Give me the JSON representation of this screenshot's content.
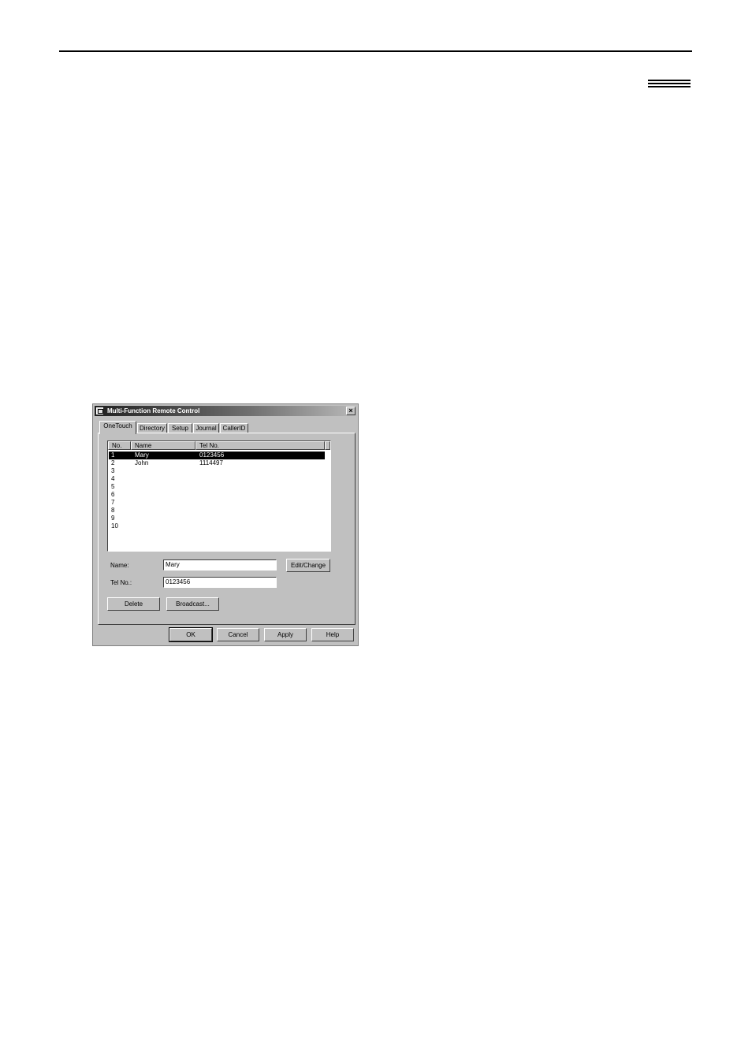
{
  "dialog": {
    "title": "Multi-Function Remote Control",
    "close_symbol": "×",
    "icon": "fax-app-icon"
  },
  "tabs": [
    {
      "label": "OneTouch",
      "active": true
    },
    {
      "label": "Directory"
    },
    {
      "label": "Setup"
    },
    {
      "label": "Journal"
    },
    {
      "label": "CallerID"
    }
  ],
  "list": {
    "columns": [
      "No.",
      "Name",
      "Tel No."
    ],
    "rows": [
      {
        "no": "1",
        "name": "Mary",
        "tel": "0123456",
        "selected": true
      },
      {
        "no": "2",
        "name": "John",
        "tel": "1114497"
      },
      {
        "no": "3",
        "name": "",
        "tel": ""
      },
      {
        "no": "4",
        "name": "",
        "tel": ""
      },
      {
        "no": "5",
        "name": "",
        "tel": ""
      },
      {
        "no": "6",
        "name": "",
        "tel": ""
      },
      {
        "no": "7",
        "name": "",
        "tel": ""
      },
      {
        "no": "8",
        "name": "",
        "tel": ""
      },
      {
        "no": "9",
        "name": "",
        "tel": ""
      },
      {
        "no": "10",
        "name": "",
        "tel": ""
      }
    ]
  },
  "form": {
    "name_label": "Name:",
    "name_value": "Mary",
    "tel_label": "Tel No.:",
    "tel_value": "0123456",
    "edit_change_label": "Edit/Change",
    "delete_label": "Delete",
    "broadcast_label": "Broadcast..."
  },
  "footer": {
    "ok_label": "OK",
    "cancel_label": "Cancel",
    "apply_label": "Apply",
    "help_label": "Help"
  }
}
